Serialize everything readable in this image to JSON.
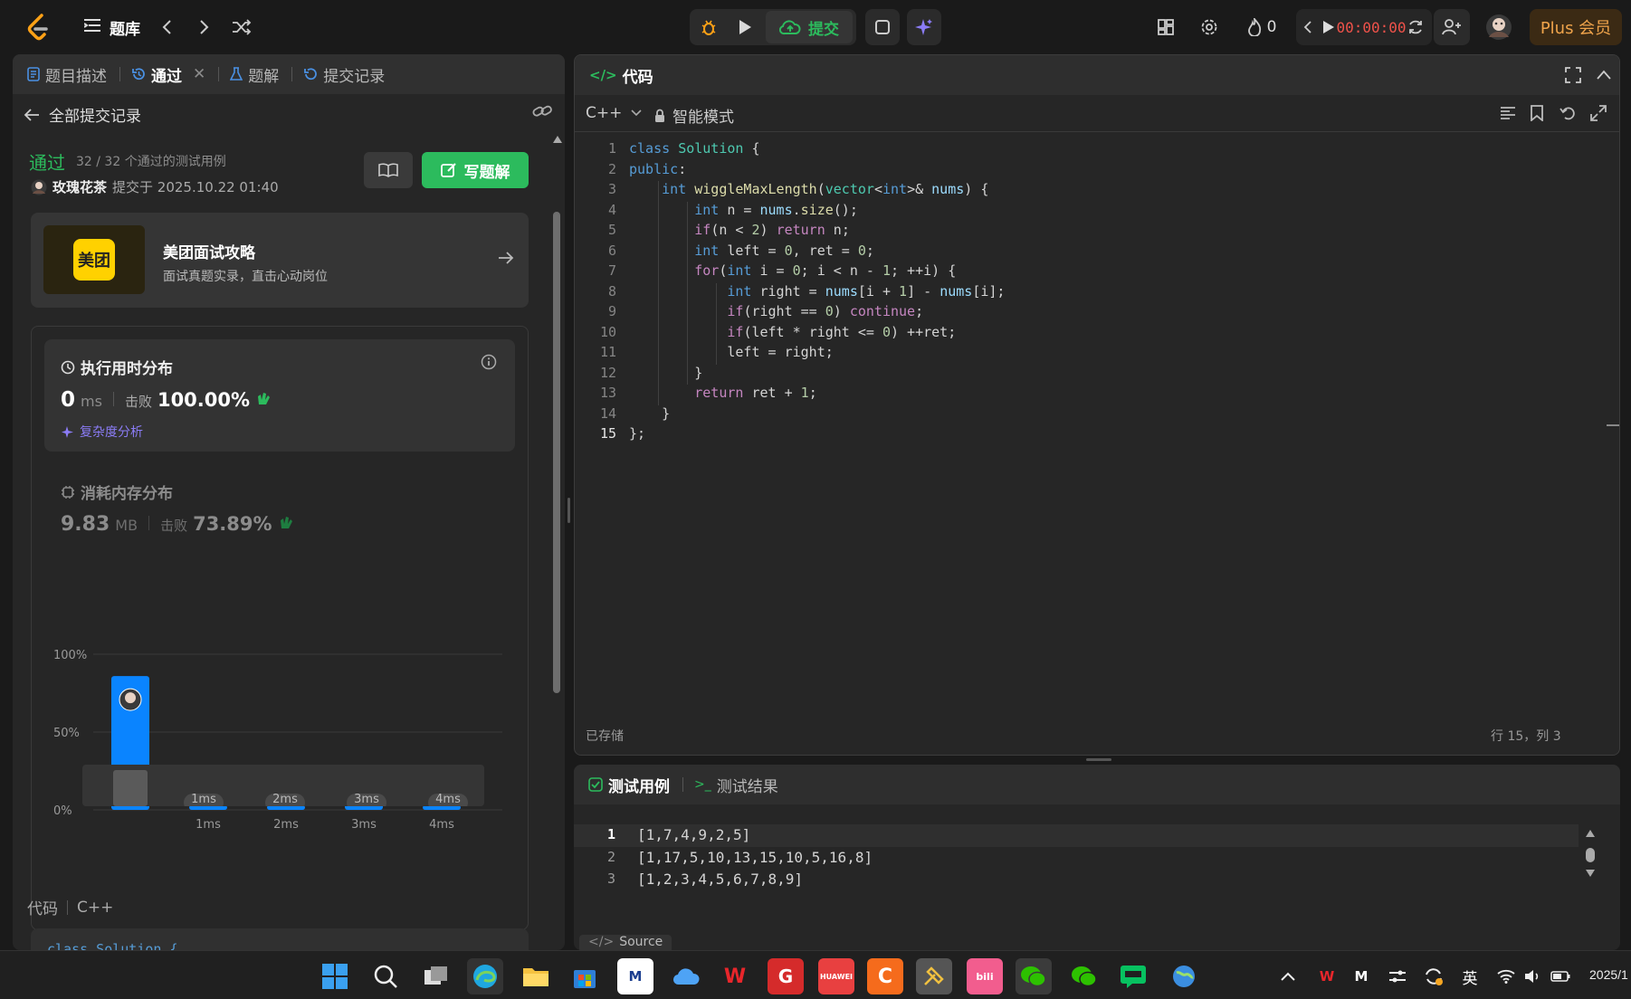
{
  "topbar": {
    "library_label": "题库",
    "submit_label": "提交",
    "streak_count": "0",
    "timer": "00:00:00",
    "plus_label": "Plus 会员"
  },
  "left_tabs": [
    {
      "label": "题目描述"
    },
    {
      "label": "通过"
    },
    {
      "label": "题解"
    },
    {
      "label": "提交记录"
    }
  ],
  "submissions": {
    "back_label": "全部提交记录",
    "status": "通过",
    "cases": "32 / 32 个通过的测试用例",
    "user": "玫瑰花茶",
    "submitted_at": "提交于 2025.10.22 01:40",
    "write_solution": "写题解"
  },
  "promo": {
    "logo_text": "美团",
    "title": "美团面试攻略",
    "subtitle": "面试真题实录，直击心动岗位"
  },
  "runtime": {
    "title": "执行用时分布",
    "value": "0",
    "unit": "ms",
    "beats_label": "击败",
    "beats": "100.00%",
    "analysis": "复杂度分析"
  },
  "memory": {
    "title": "消耗内存分布",
    "value": "9.83",
    "unit": "MB",
    "beats_label": "击败",
    "beats": "73.89%"
  },
  "chart_data": {
    "type": "bar",
    "categories": [
      "0ms",
      "1ms",
      "2ms",
      "3ms",
      "4ms"
    ],
    "tick_labels": [
      "",
      "1ms",
      "2ms",
      "3ms",
      "4ms"
    ],
    "values": [
      86,
      3,
      3,
      5,
      3
    ],
    "ylim": [
      0,
      100
    ],
    "y_ticks": [
      "100%",
      "50%",
      "0%"
    ],
    "grid": true,
    "bar_color": "#0a84ff"
  },
  "left_footer": {
    "code_label": "代码",
    "lang": "C++",
    "code_preview": "class Solution {"
  },
  "editor": {
    "title": "代码",
    "lang": "C++",
    "mode": "智能模式",
    "saved": "已存储",
    "cursor": "行 15，列 3",
    "lines": [
      "class Solution {",
      "public:",
      "    int wiggleMaxLength(vector<int>& nums) {",
      "        int n = nums.size();",
      "        if(n < 2) return n;",
      "        int left = 0, ret = 0;",
      "        for(int i = 0; i < n - 1; ++i) {",
      "            int right = nums[i + 1] - nums[i];",
      "            if(right == 0) continue;",
      "            if(left * right <= 0) ++ret;",
      "            left = right;",
      "        }",
      "        return ret + 1;",
      "    }",
      "};"
    ]
  },
  "testcases": {
    "tab_cases": "测试用例",
    "tab_results": "测试结果",
    "lines": [
      "[1,7,4,9,2,5]",
      "[1,17,5,10,13,15,10,5,16,8]",
      "[1,2,3,4,5,6,7,8,9]"
    ],
    "source_label": "Source"
  },
  "taskbar": {
    "lang_indicator": "英",
    "clock": "2025/1"
  }
}
